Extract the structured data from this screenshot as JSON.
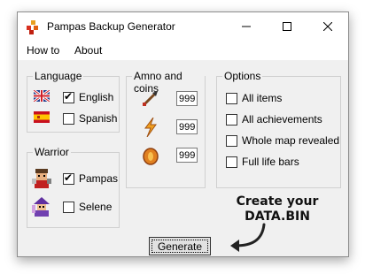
{
  "window": {
    "title": "Pampas Backup Generator"
  },
  "title_icons": {
    "app": "pampas-app-icon",
    "minimize": "minimize-icon",
    "maximize": "maximize-icon",
    "close": "close-icon"
  },
  "menu": {
    "items": [
      "How to",
      "About"
    ]
  },
  "language": {
    "label": "Language",
    "options": [
      {
        "label": "English",
        "checked": true,
        "icon": "uk-flag-icon"
      },
      {
        "label": "Spanish",
        "checked": false,
        "icon": "spain-flag-icon"
      }
    ]
  },
  "warrior": {
    "label": "Warrior",
    "options": [
      {
        "label": "Pampas",
        "checked": true,
        "icon": "pampas-portrait-icon"
      },
      {
        "label": "Selene",
        "checked": false,
        "icon": "selene-portrait-icon"
      }
    ]
  },
  "ammo": {
    "label": "Amno and coins",
    "fields": [
      {
        "value": "999",
        "icon": "arrow-icon"
      },
      {
        "value": "999",
        "icon": "lightning-icon"
      },
      {
        "value": "999",
        "icon": "coin-icon"
      }
    ]
  },
  "options": {
    "label": "Options",
    "items": [
      {
        "label": "All items",
        "checked": false
      },
      {
        "label": "All achievements",
        "checked": false
      },
      {
        "label": "Whole map revealed",
        "checked": false
      },
      {
        "label": "Full life bars",
        "checked": false
      }
    ]
  },
  "generate": {
    "label": "Generate"
  },
  "annotation": {
    "line1": "Create your",
    "line2": "DATA.BIN",
    "arrow_icon": "curved-arrow-icon"
  },
  "colors": {
    "check": "#000000",
    "window_bg": "#f0f0f0",
    "titlebar_bg": "#ffffff"
  }
}
